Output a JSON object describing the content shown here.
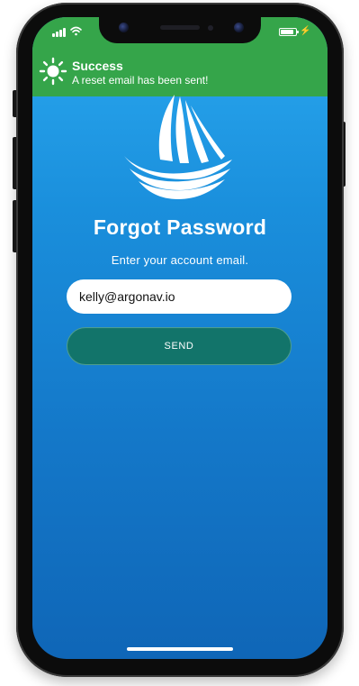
{
  "status_bar": {
    "battery_level": 0.85,
    "charging": true,
    "bar_color": "#35a54a"
  },
  "toast": {
    "icon": "sun-icon",
    "title": "Success",
    "message": "A reset email has been sent!"
  },
  "logo": {
    "icon": "sailboat-logo-icon"
  },
  "form": {
    "title": "Forgot Password",
    "subtitle": "Enter your account email.",
    "email_value": "kelly@argonav.io",
    "send_label": "SEND"
  },
  "colors": {
    "accent": "#12746a",
    "background_top": "#2aa8ef",
    "background_bottom": "#0f66b7",
    "success": "#35a54a"
  }
}
